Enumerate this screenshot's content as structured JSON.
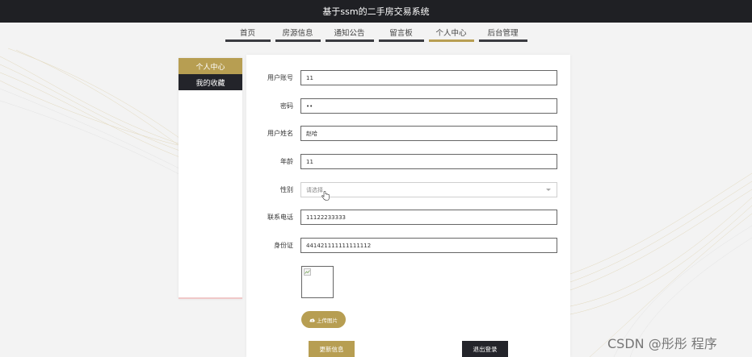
{
  "header": {
    "title": "基于ssm的二手房交易系统"
  },
  "nav": {
    "items": [
      {
        "label": "首页"
      },
      {
        "label": "房源信息"
      },
      {
        "label": "通知公告"
      },
      {
        "label": "留言板"
      },
      {
        "label": "个人中心",
        "active": true
      },
      {
        "label": "后台管理"
      }
    ]
  },
  "sidebar": {
    "items": [
      {
        "label": "个人中心",
        "active": true
      },
      {
        "label": "我的收藏"
      }
    ]
  },
  "form": {
    "account": {
      "label": "用户账号",
      "value": "11"
    },
    "password": {
      "label": "密码",
      "value": "••"
    },
    "name": {
      "label": "用户姓名",
      "value": "赵哈"
    },
    "age": {
      "label": "年龄",
      "value": "11"
    },
    "gender": {
      "label": "性别",
      "placeholder": "请选择"
    },
    "phone": {
      "label": "联系电话",
      "value": "11122233333"
    },
    "idcard": {
      "label": "身份证",
      "value": "441421111111111112"
    },
    "upload_label": "上传图片",
    "update_label": "更新信息",
    "logout_label": "退出登录"
  },
  "watermark": "CSDN @彤彤 程序",
  "colors": {
    "accent": "#b79e52",
    "dark": "#23242a",
    "topbar": "#1f2024"
  }
}
